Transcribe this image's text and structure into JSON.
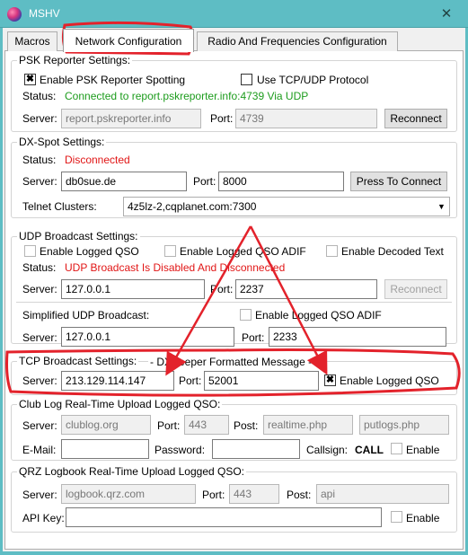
{
  "window": {
    "title": "MSHV",
    "close_glyph": "✕"
  },
  "tabs": [
    {
      "label": "Macros"
    },
    {
      "label": "Network Configuration"
    },
    {
      "label": "Radio And Frequencies Configuration"
    }
  ],
  "psk": {
    "title": "PSK Reporter Settings:",
    "enable_label": "Enable PSK Reporter Spotting",
    "enable_checked": "✖",
    "tcpudp_label": "Use TCP/UDP Protocol",
    "status_label": "Status:",
    "status_value": "Connected to report.pskreporter.info:4739 Via UDP",
    "server_label": "Server:",
    "server_value": "report.pskreporter.info",
    "port_label": "Port:",
    "port_value": "4739",
    "reconnect_label": "Reconnect"
  },
  "dxspot": {
    "title": "DX-Spot Settings:",
    "status_label": "Status:",
    "status_value": "Disconnected",
    "server_label": "Server:",
    "server_value": "db0sue.de",
    "port_label": "Port:",
    "port_value": "8000",
    "connect_label": "Press To Connect",
    "telnet_label": "Telnet Clusters:",
    "telnet_value": "4z5lz-2,cqplanet.com:7300",
    "dropdown_glyph": "▼"
  },
  "udp": {
    "title": "UDP Broadcast Settings:",
    "logged_qso_label": "Enable Logged QSO",
    "logged_adif_label": "Enable Logged QSO ADIF",
    "decoded_label": "Enable Decoded Text",
    "status_label": "Status:",
    "status_value": "UDP Broadcast Is Disabled And Disconnected",
    "server_label": "Server:",
    "server_value": "127.0.0.1",
    "port_label": "Port:",
    "port_value": "2237",
    "reconnect_label": "Reconnect",
    "simplified_label": "Simplified UDP Broadcast:",
    "simplified_adif_label": "Enable Logged QSO ADIF",
    "simp_server_label": "Server:",
    "simp_server_value": "127.0.0.1",
    "simp_port_label": "Port:",
    "simp_port_value": "2233"
  },
  "tcp": {
    "title": "TCP Broadcast Settings:",
    "subtitle": "- DXKeeper Formatted Message -",
    "server_label": "Server:",
    "server_value": "213.129.114.147",
    "port_label": "Port:",
    "port_value": "52001",
    "enable_label": "Enable Logged QSO",
    "enable_checked": "✖"
  },
  "clublog": {
    "title": "Club Log Real-Time Upload Logged QSO:",
    "server_label": "Server:",
    "server_value": "clublog.org",
    "port_label": "Port:",
    "port_value": "443",
    "post_label": "Post:",
    "post_value": "realtime.php",
    "post2_value": "putlogs.php",
    "email_label": "E-Mail:",
    "email_value": "",
    "password_label": "Password:",
    "password_value": "",
    "callsign_label": "Callsign:",
    "callsign_value": "CALL",
    "enable_label": "Enable"
  },
  "qrz": {
    "title": "QRZ Logbook Real-Time Upload Logged QSO:",
    "server_label": "Server:",
    "server_value": "logbook.qrz.com",
    "port_label": "Port:",
    "port_value": "443",
    "post_label": "Post:",
    "post_value": "api",
    "apikey_label": "API Key:",
    "apikey_value": "",
    "enable_label": "Enable"
  },
  "colors": {
    "annotation": "#e3222b",
    "connected": "#1d9c1d",
    "error": "#e11616",
    "titlebar": "#5ebdc4"
  }
}
